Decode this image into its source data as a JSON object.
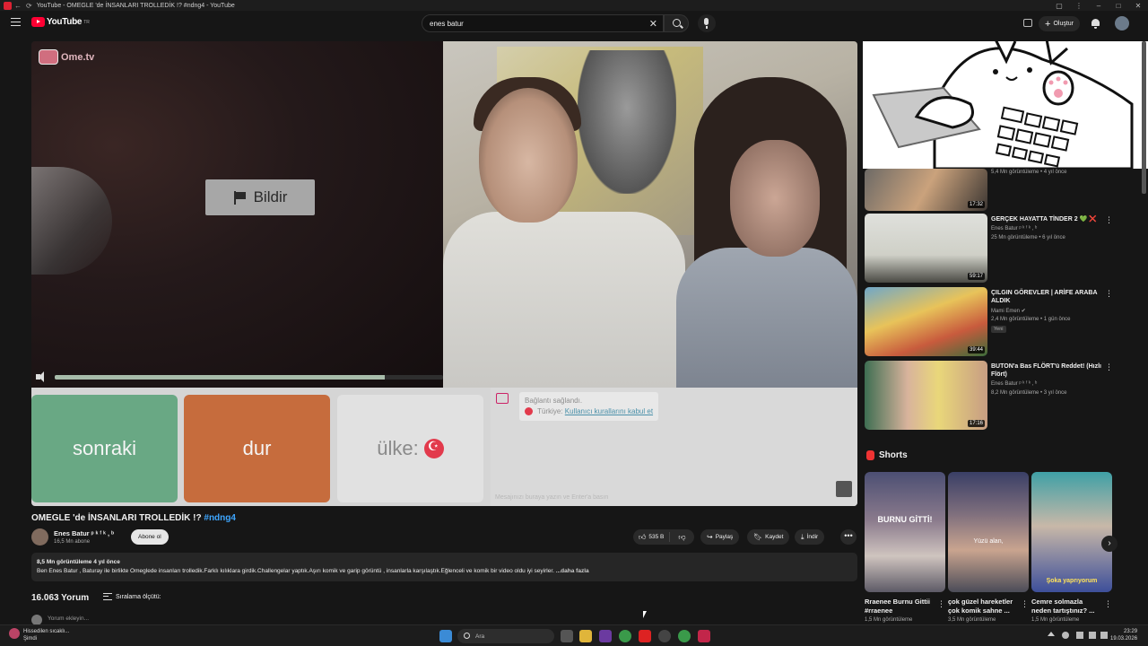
{
  "window": {
    "title": "YouTube - OMEGLE 'de İNSANLARI TROLLEDİK !? #ndng4 - YouTube"
  },
  "header": {
    "logo_text": "YouTube",
    "logo_sup": "TR",
    "search_value": "enes batur",
    "create_label": "Oluştur"
  },
  "player": {
    "watermark": "Ome.tv",
    "report_label": "Bildir",
    "progress_percent": 85,
    "next_label": "sonraki",
    "stop_label": "dur",
    "country_label": "ülke:",
    "chat_connected": "Bağlantı sağlandı.",
    "chat_country_prefix": "Türkiye:",
    "chat_country_link": "Kullanıcı kurallarını kabul et",
    "chat_input_placeholder": "Mesajınızı buraya yazın ve Enter'a basın"
  },
  "video": {
    "title": "OMEGLE 'de İNSANLARI TROLLEDİK !?",
    "hashtag": "#ndng4",
    "channel_name": "Enes Batur ᵖ ᵏ ᶠ ᵏ , ᵇ",
    "channel_subs": "16,5 Mn abone",
    "subscribe_label": "Abone ol",
    "likes": "535 B",
    "share_label": "Paylaş",
    "save_label": "Kaydet",
    "download_label": "İndir",
    "more_label": "•••",
    "views_meta": "8,5 Mn görüntüleme  4 yıl önce",
    "description": "Ben Enes Batur , Baturay ile birlikte Omeglede insanları trolledik.Farklı kılıklara girdik.Challengelar yaptık.Aşırı komik ve garip görüntü , insanlarla karşılaştık.Eğlenceli ve komik bir video oldu iyi seyirler.",
    "show_more": "...daha fazla"
  },
  "comments": {
    "count_label": "16.063 Yorum",
    "sort_label": "Sıralama ölçütü:",
    "add_placeholder": "Yorum ekleyin..."
  },
  "sidebar": {
    "recommendations": [
      {
        "title": "",
        "channel": "",
        "views": "5,4 Mn görüntüleme • 4 yıl önce",
        "duration": "17:32",
        "badge": ""
      },
      {
        "title": "GERÇEK HAYATTA TİNDER 2 💚 ❌",
        "channel": "Enes Batur ᵖ ᵏ ᶠ ᵏ , ᵇ",
        "views": "25 Mn görüntüleme • 6 yıl önce",
        "duration": "59:17",
        "badge": ""
      },
      {
        "title": "ÇILGIN GÖREVLER | ARİFE ARABA ALDIK",
        "channel": "Mami Emen ✔",
        "views": "2,4 Mn görüntüleme • 1 gün önce",
        "duration": "39:44",
        "badge": "Yeni"
      },
      {
        "title": "BUTON'a Bas FLÖRT'ü Reddet! (Hızlı Flört)",
        "channel": "Enes Batur ᵖ ᵏ ᶠ ᵏ , ᵇ",
        "views": "8,2 Mn görüntüleme • 3 yıl önce",
        "duration": "17:16",
        "badge": ""
      }
    ],
    "shorts_heading": "Shorts",
    "shorts": [
      {
        "title": "Rraenee Burnu Gittii #rraenee",
        "views": "1,5 Mn görüntüleme",
        "caption": "BURNU GİTTİ!"
      },
      {
        "title": "çok güzel hareketler çok komik sahne ...",
        "views": "3,5 Mn görüntüleme",
        "caption": "Yüzü alan,"
      },
      {
        "title": "Cemre solmazla neden tartıştınız? ...",
        "views": "1,5 Mn görüntüleme",
        "caption": "Şoka yaprıyorum"
      }
    ]
  },
  "taskbar": {
    "weather_line1": "Hissedilen sıcaklı...",
    "weather_line2": "Şimdi",
    "search_placeholder": "Ara",
    "time": "23:29",
    "date": "19.03.2026"
  },
  "colors": {
    "accent_red": "#ff0033",
    "next_green": "#69a884",
    "stop_orange": "#c66c3d",
    "link_blue": "#3ea6ff"
  }
}
